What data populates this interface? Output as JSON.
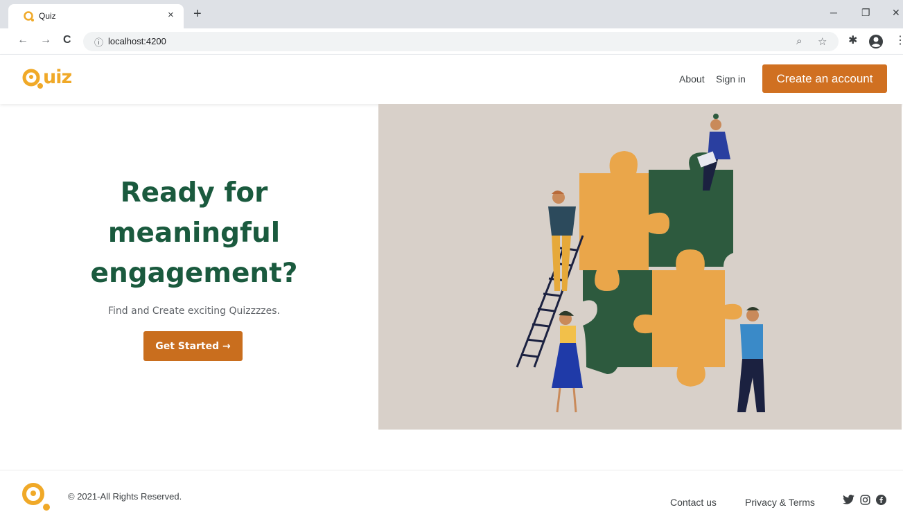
{
  "browser": {
    "tab_title": "Quiz",
    "tab_close": "×",
    "new_tab": "+",
    "url": "localhost:4200",
    "back": "←",
    "forward": "→",
    "reload": "C",
    "info": "ⓘ",
    "zoom_icon": "⌕",
    "star_icon": "☆",
    "extensions_icon": "✱",
    "menu_icon": "⋮",
    "minimize": "─",
    "maximize": "❐",
    "close": "✕"
  },
  "header": {
    "logo_text": "uiz",
    "nav": [
      "About",
      "Sign in"
    ],
    "cta": "Create an account"
  },
  "hero": {
    "title_lines": [
      "Ready for",
      "meaningful",
      "engagement?"
    ],
    "subtitle": "Find and Create exciting Quizzzzes.",
    "button": "Get Started →"
  },
  "footer": {
    "copyright": "© 2021-All Rights Reserved.",
    "links": [
      "Contact us",
      "Privacy & Terms"
    ],
    "social": [
      "twitter-icon",
      "instagram-icon",
      "facebook-icon"
    ]
  },
  "colors": {
    "brand": "#f0a928",
    "cta": "#d07021",
    "headline": "#1a5a3e",
    "illustration_bg": "#d8d0c9",
    "puzzle_green": "#2d5a3e",
    "puzzle_orange": "#eaa64a"
  }
}
